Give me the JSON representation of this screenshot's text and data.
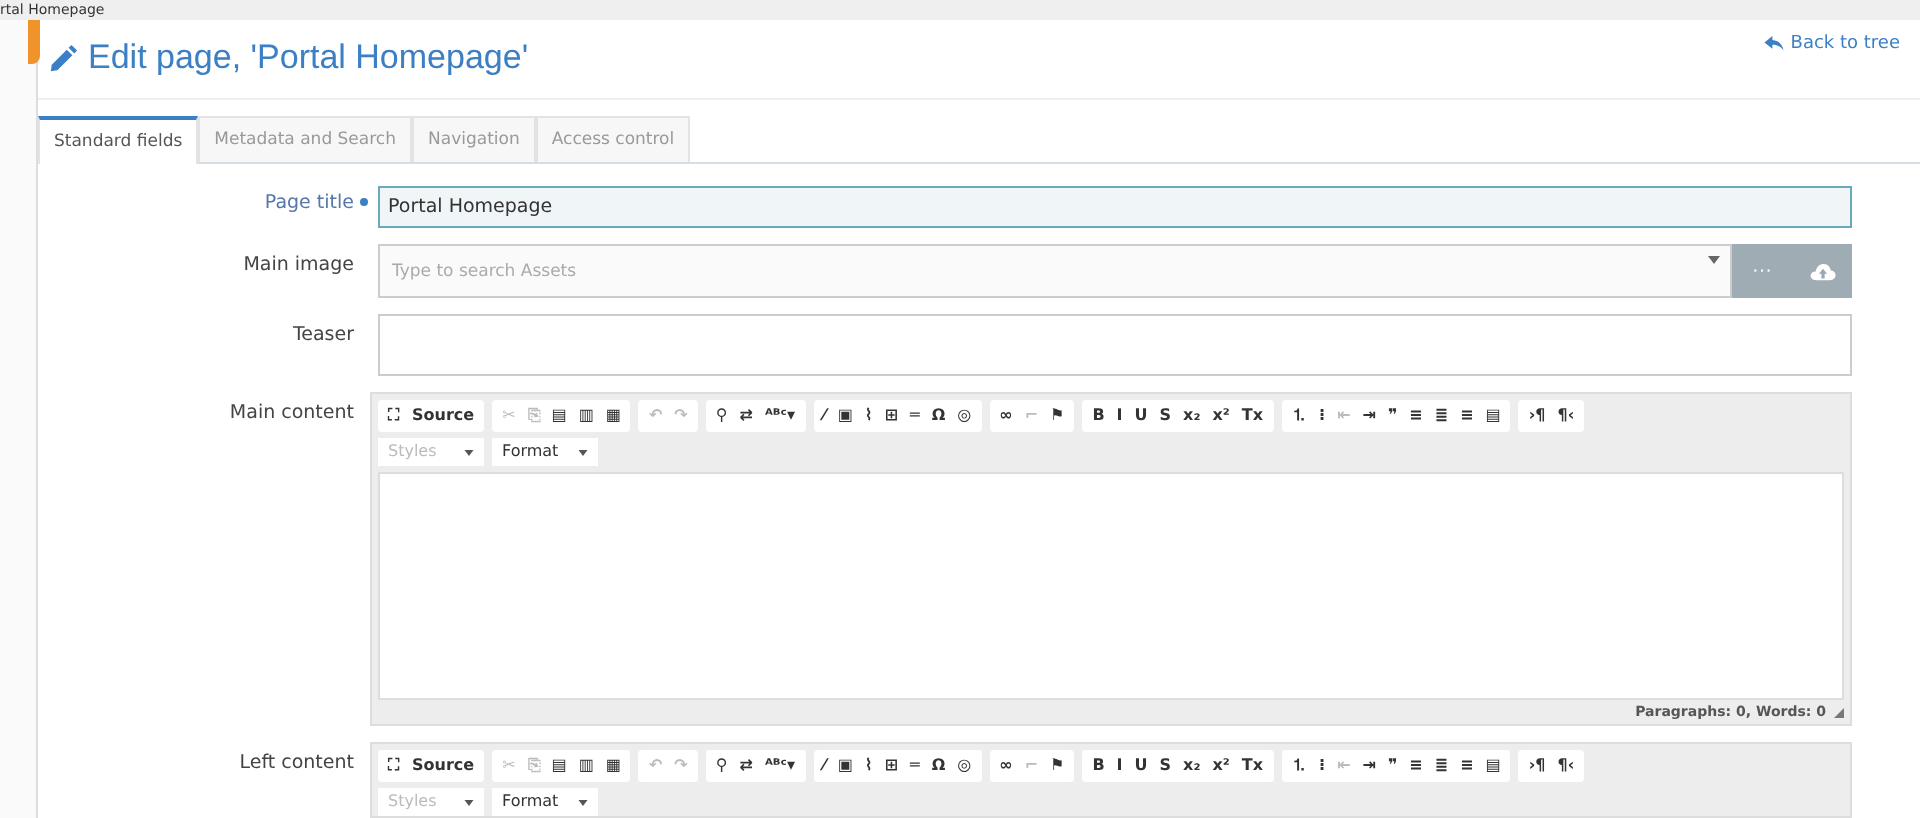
{
  "top_strip": {
    "text": "rtal Homepage"
  },
  "header": {
    "title": "Edit page, 'Portal Homepage'",
    "back_link": "Back to tree"
  },
  "tabs": [
    {
      "label": "Standard fields",
      "selected": true
    },
    {
      "label": "Metadata and Search",
      "selected": false
    },
    {
      "label": "Navigation",
      "selected": false
    },
    {
      "label": "Access control",
      "selected": false
    }
  ],
  "fields": [
    {
      "kind": "text",
      "label": "Page title",
      "required": true,
      "value": "Portal Homepage"
    },
    {
      "kind": "asset",
      "label": "Main image",
      "required": false,
      "placeholder": "Type to search Assets",
      "buttons": [
        "···"
      ]
    },
    {
      "kind": "textarea",
      "label": "Teaser",
      "required": false
    },
    {
      "kind": "editor",
      "label": "Main content",
      "required": false,
      "status": "Paragraphs: 0, Words: 0",
      "toolbar": [
        [
          {
            "g": "⛶",
            "d": false
          },
          {
            "g": "Source",
            "d": false
          }
        ],
        [
          {
            "g": "✂",
            "d": true
          },
          {
            "g": "⎘",
            "d": true
          },
          {
            "g": "▤",
            "d": false
          },
          {
            "g": "▥",
            "d": false
          },
          {
            "g": "▦",
            "d": false
          }
        ],
        [
          {
            "g": "↶",
            "d": true
          },
          {
            "g": "↷",
            "d": true
          }
        ],
        [
          {
            "g": "⚲",
            "d": false
          },
          {
            "g": "⇄",
            "d": false
          },
          {
            "g": "ᴬᴮᶜ▾",
            "d": false
          }
        ],
        [
          {
            "g": "⁄",
            "d": false
          },
          {
            "g": "▣",
            "d": false
          },
          {
            "g": "⌇",
            "d": false
          },
          {
            "g": "⊞",
            "d": false
          },
          {
            "g": "═",
            "d": false
          },
          {
            "g": "Ω",
            "d": false
          },
          {
            "g": "◎",
            "d": false
          }
        ],
        [
          {
            "g": "∞",
            "d": false
          },
          {
            "g": "⌐",
            "d": true
          },
          {
            "g": "⚑",
            "d": false
          }
        ],
        [
          {
            "g": "B",
            "d": false
          },
          {
            "g": "I",
            "d": false
          },
          {
            "g": "U",
            "d": false
          },
          {
            "g": "S",
            "d": false
          },
          {
            "g": "x₂",
            "d": false
          },
          {
            "g": "x²",
            "d": false
          },
          {
            "g": "Tx",
            "d": false
          }
        ],
        [
          {
            "g": "⒈",
            "d": false
          },
          {
            "g": "⁝",
            "d": false
          },
          {
            "g": "⇤",
            "d": true
          },
          {
            "g": "⇥",
            "d": false
          },
          {
            "g": "❞",
            "d": false
          },
          {
            "g": "≡",
            "d": false
          },
          {
            "g": "≣",
            "d": false
          },
          {
            "g": "≡",
            "d": false
          },
          {
            "g": "▤",
            "d": false
          }
        ],
        [
          {
            "g": "›¶",
            "d": false
          },
          {
            "g": "¶‹",
            "d": false
          }
        ]
      ],
      "combos": [
        {
          "label": "Styles",
          "disabled": true
        },
        {
          "label": "Format",
          "disabled": false
        }
      ]
    },
    {
      "kind": "editor",
      "label": "Left content",
      "required": false,
      "toolbar": [
        [
          {
            "g": "⛶",
            "d": false
          },
          {
            "g": "Source",
            "d": false
          }
        ],
        [
          {
            "g": "✂",
            "d": true
          },
          {
            "g": "⎘",
            "d": true
          },
          {
            "g": "▤",
            "d": false
          },
          {
            "g": "▥",
            "d": false
          },
          {
            "g": "▦",
            "d": false
          }
        ],
        [
          {
            "g": "↶",
            "d": true
          },
          {
            "g": "↷",
            "d": true
          }
        ],
        [
          {
            "g": "⚲",
            "d": false
          },
          {
            "g": "⇄",
            "d": false
          },
          {
            "g": "ᴬᴮᶜ▾",
            "d": false
          }
        ],
        [
          {
            "g": "⁄",
            "d": false
          },
          {
            "g": "▣",
            "d": false
          },
          {
            "g": "⌇",
            "d": false
          },
          {
            "g": "⊞",
            "d": false
          },
          {
            "g": "═",
            "d": false
          },
          {
            "g": "Ω",
            "d": false
          },
          {
            "g": "◎",
            "d": false
          }
        ],
        [
          {
            "g": "∞",
            "d": false
          },
          {
            "g": "⌐",
            "d": true
          },
          {
            "g": "⚑",
            "d": false
          }
        ],
        [
          {
            "g": "B",
            "d": false
          },
          {
            "g": "I",
            "d": false
          },
          {
            "g": "U",
            "d": false
          },
          {
            "g": "S",
            "d": false
          },
          {
            "g": "x₂",
            "d": false
          },
          {
            "g": "x²",
            "d": false
          },
          {
            "g": "Tx",
            "d": false
          }
        ],
        [
          {
            "g": "⒈",
            "d": false
          },
          {
            "g": "⁝",
            "d": false
          },
          {
            "g": "⇤",
            "d": true
          },
          {
            "g": "⇥",
            "d": false
          },
          {
            "g": "❞",
            "d": false
          },
          {
            "g": "≡",
            "d": false
          },
          {
            "g": "≣",
            "d": false
          },
          {
            "g": "≡",
            "d": false
          },
          {
            "g": "▤",
            "d": false
          }
        ],
        [
          {
            "g": "›¶",
            "d": false
          },
          {
            "g": "¶‹",
            "d": false
          }
        ]
      ],
      "combos": [
        {
          "label": "Styles",
          "disabled": true
        },
        {
          "label": "Format",
          "disabled": false
        }
      ]
    }
  ]
}
